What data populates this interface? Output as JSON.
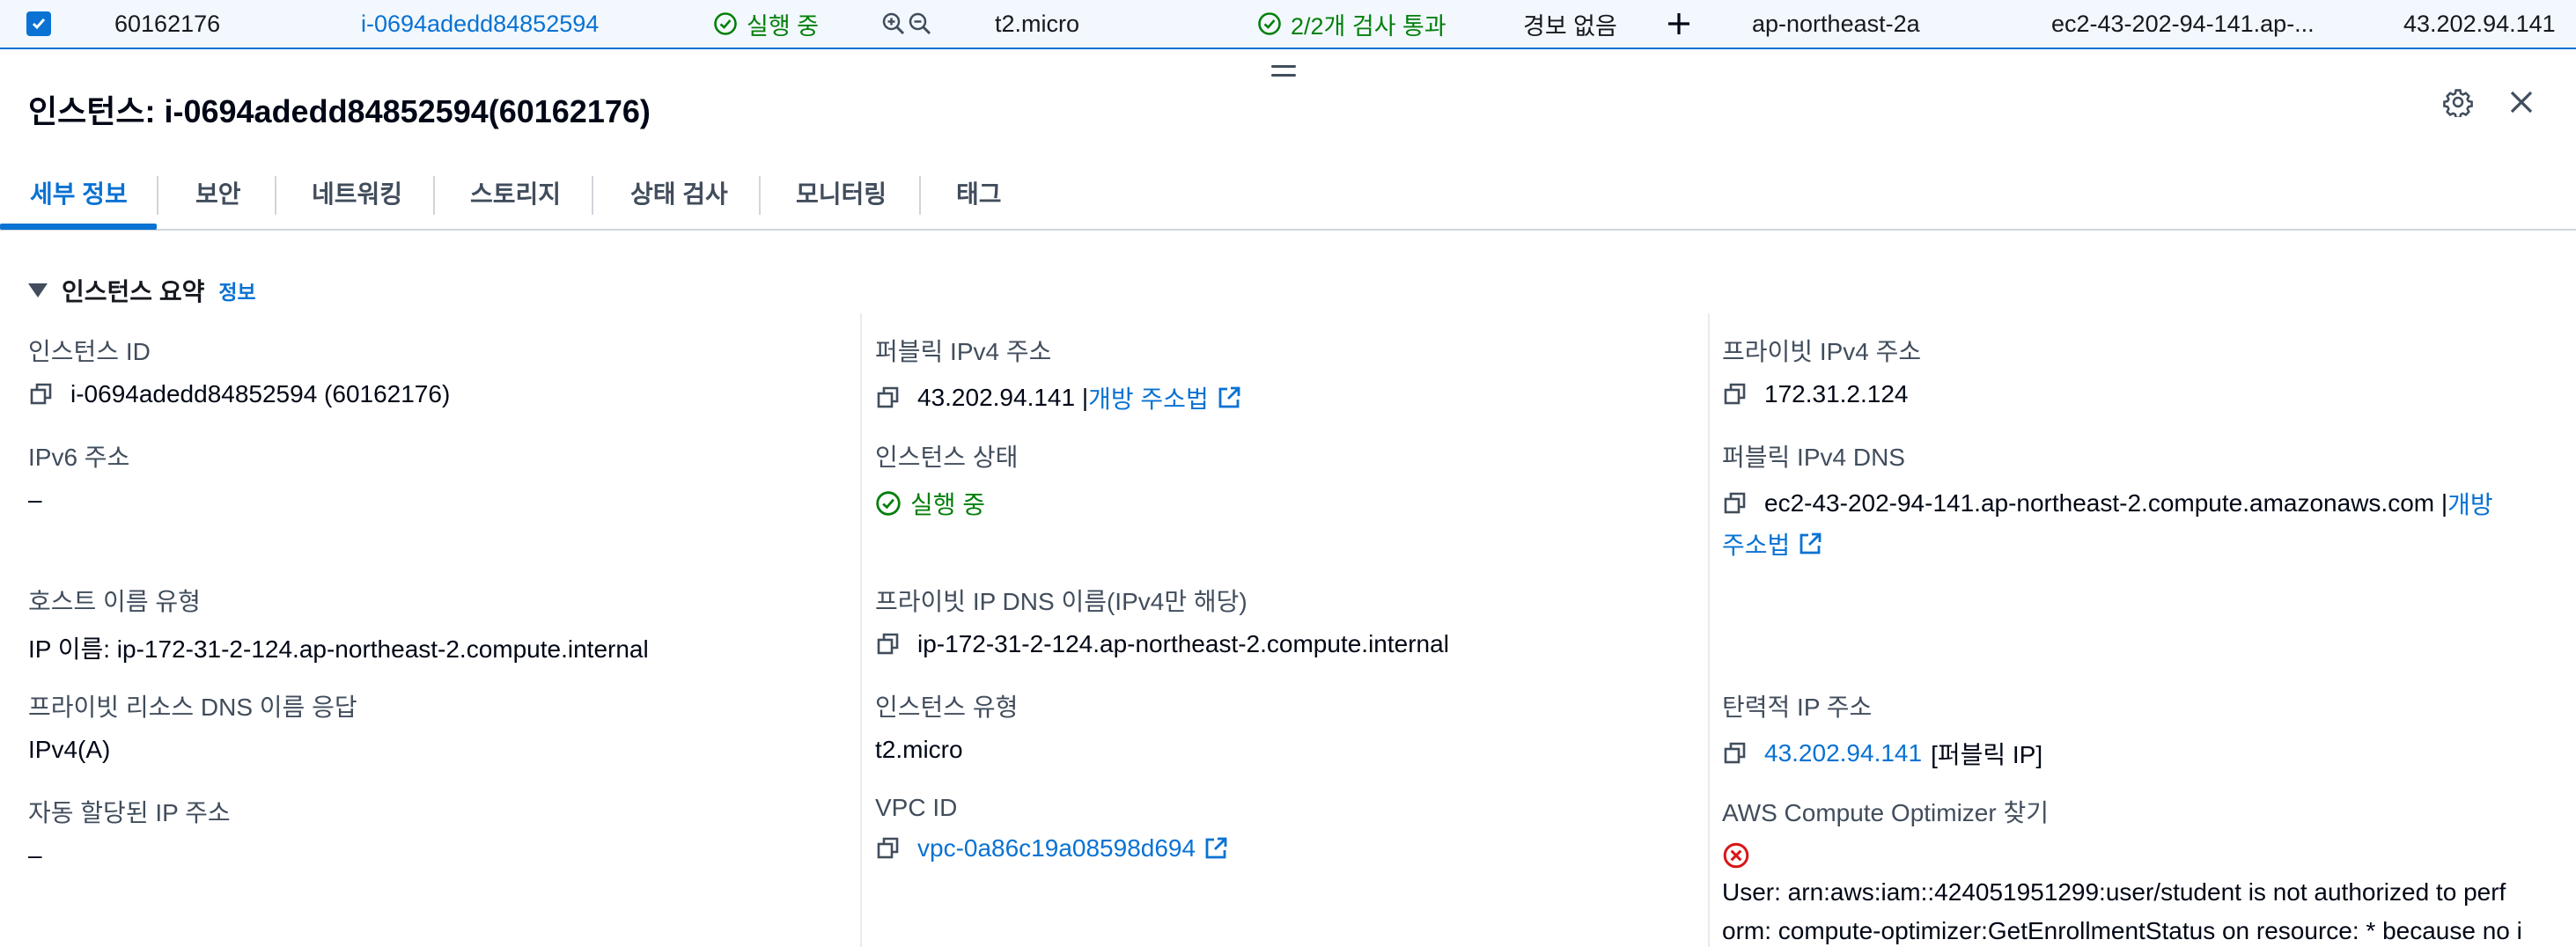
{
  "top_row": {
    "row_id": "60162176",
    "instance_id": "i-0694adedd84852594",
    "state": "실행 중",
    "type": "t2.micro",
    "status_check": "2/2개 검사 통과",
    "alarm": "경보 없음",
    "az": "ap-northeast-2a",
    "public_dns": "ec2-43-202-94-141.ap-...",
    "public_ip": "43.202.94.141"
  },
  "header": {
    "title": "인스턴스: i-0694adedd84852594(60162176)"
  },
  "tabs": [
    {
      "label": "세부 정보"
    },
    {
      "label": "보안"
    },
    {
      "label": "네트워킹"
    },
    {
      "label": "스토리지"
    },
    {
      "label": "상태 검사"
    },
    {
      "label": "모니터링"
    },
    {
      "label": "태그"
    }
  ],
  "section": {
    "title": "인스턴스 요약",
    "info_link": "정보"
  },
  "fields": {
    "instance_id": {
      "label": "인스턴스 ID",
      "value": "i-0694adedd84852594 (60162176)"
    },
    "ipv6": {
      "label": "IPv6 주소",
      "value": "–"
    },
    "hostname_type": {
      "label": "호스트 이름 유형",
      "value": "IP 이름: ip-172-31-2-124.ap-northeast-2.compute.internal"
    },
    "private_dns_answer": {
      "label": "프라이빗 리소스 DNS 이름 응답",
      "value": "IPv4(A)"
    },
    "auto_ip": {
      "label": "자동 할당된 IP 주소",
      "value": "–"
    },
    "public_ipv4": {
      "label": "퍼블릭 IPv4 주소",
      "value": "43.202.94.141 |",
      "link": "개방 주소법"
    },
    "instance_state": {
      "label": "인스턴스 상태",
      "value": "실행 중"
    },
    "private_ip_dns": {
      "label": "프라이빗 IP DNS 이름(IPv4만 해당)",
      "value": "ip-172-31-2-124.ap-northeast-2.compute.internal"
    },
    "instance_type": {
      "label": "인스턴스 유형",
      "value": "t2.micro"
    },
    "vpc_id": {
      "label": "VPC ID",
      "value": "vpc-0a86c19a08598d694"
    },
    "private_ipv4": {
      "label": "프라이빗 IPv4 주소",
      "value": "172.31.2.124"
    },
    "public_dns": {
      "label": "퍼블릭 IPv4 DNS",
      "value": "ec2-43-202-94-141.ap-northeast-2.compute.amazonaws.com |",
      "link_part1": "개방",
      "link_part2": "주소법"
    },
    "elastic_ip": {
      "label": "탄력적 IP 주소",
      "value": "43.202.94.141",
      "suffix": "[퍼블릭 IP]"
    },
    "optimizer": {
      "label": "AWS Compute Optimizer 찾기",
      "error_line1": "User: arn:aws:iam::424051951299:user/student is not authorized to perf",
      "error_line2": "orm: compute-optimizer:GetEnrollmentStatus on resource: * because no i"
    }
  },
  "colors": {
    "link": "#0972d3",
    "success": "#037f0c",
    "error": "#d91515",
    "text": "#000716",
    "label": "#414d5c"
  }
}
